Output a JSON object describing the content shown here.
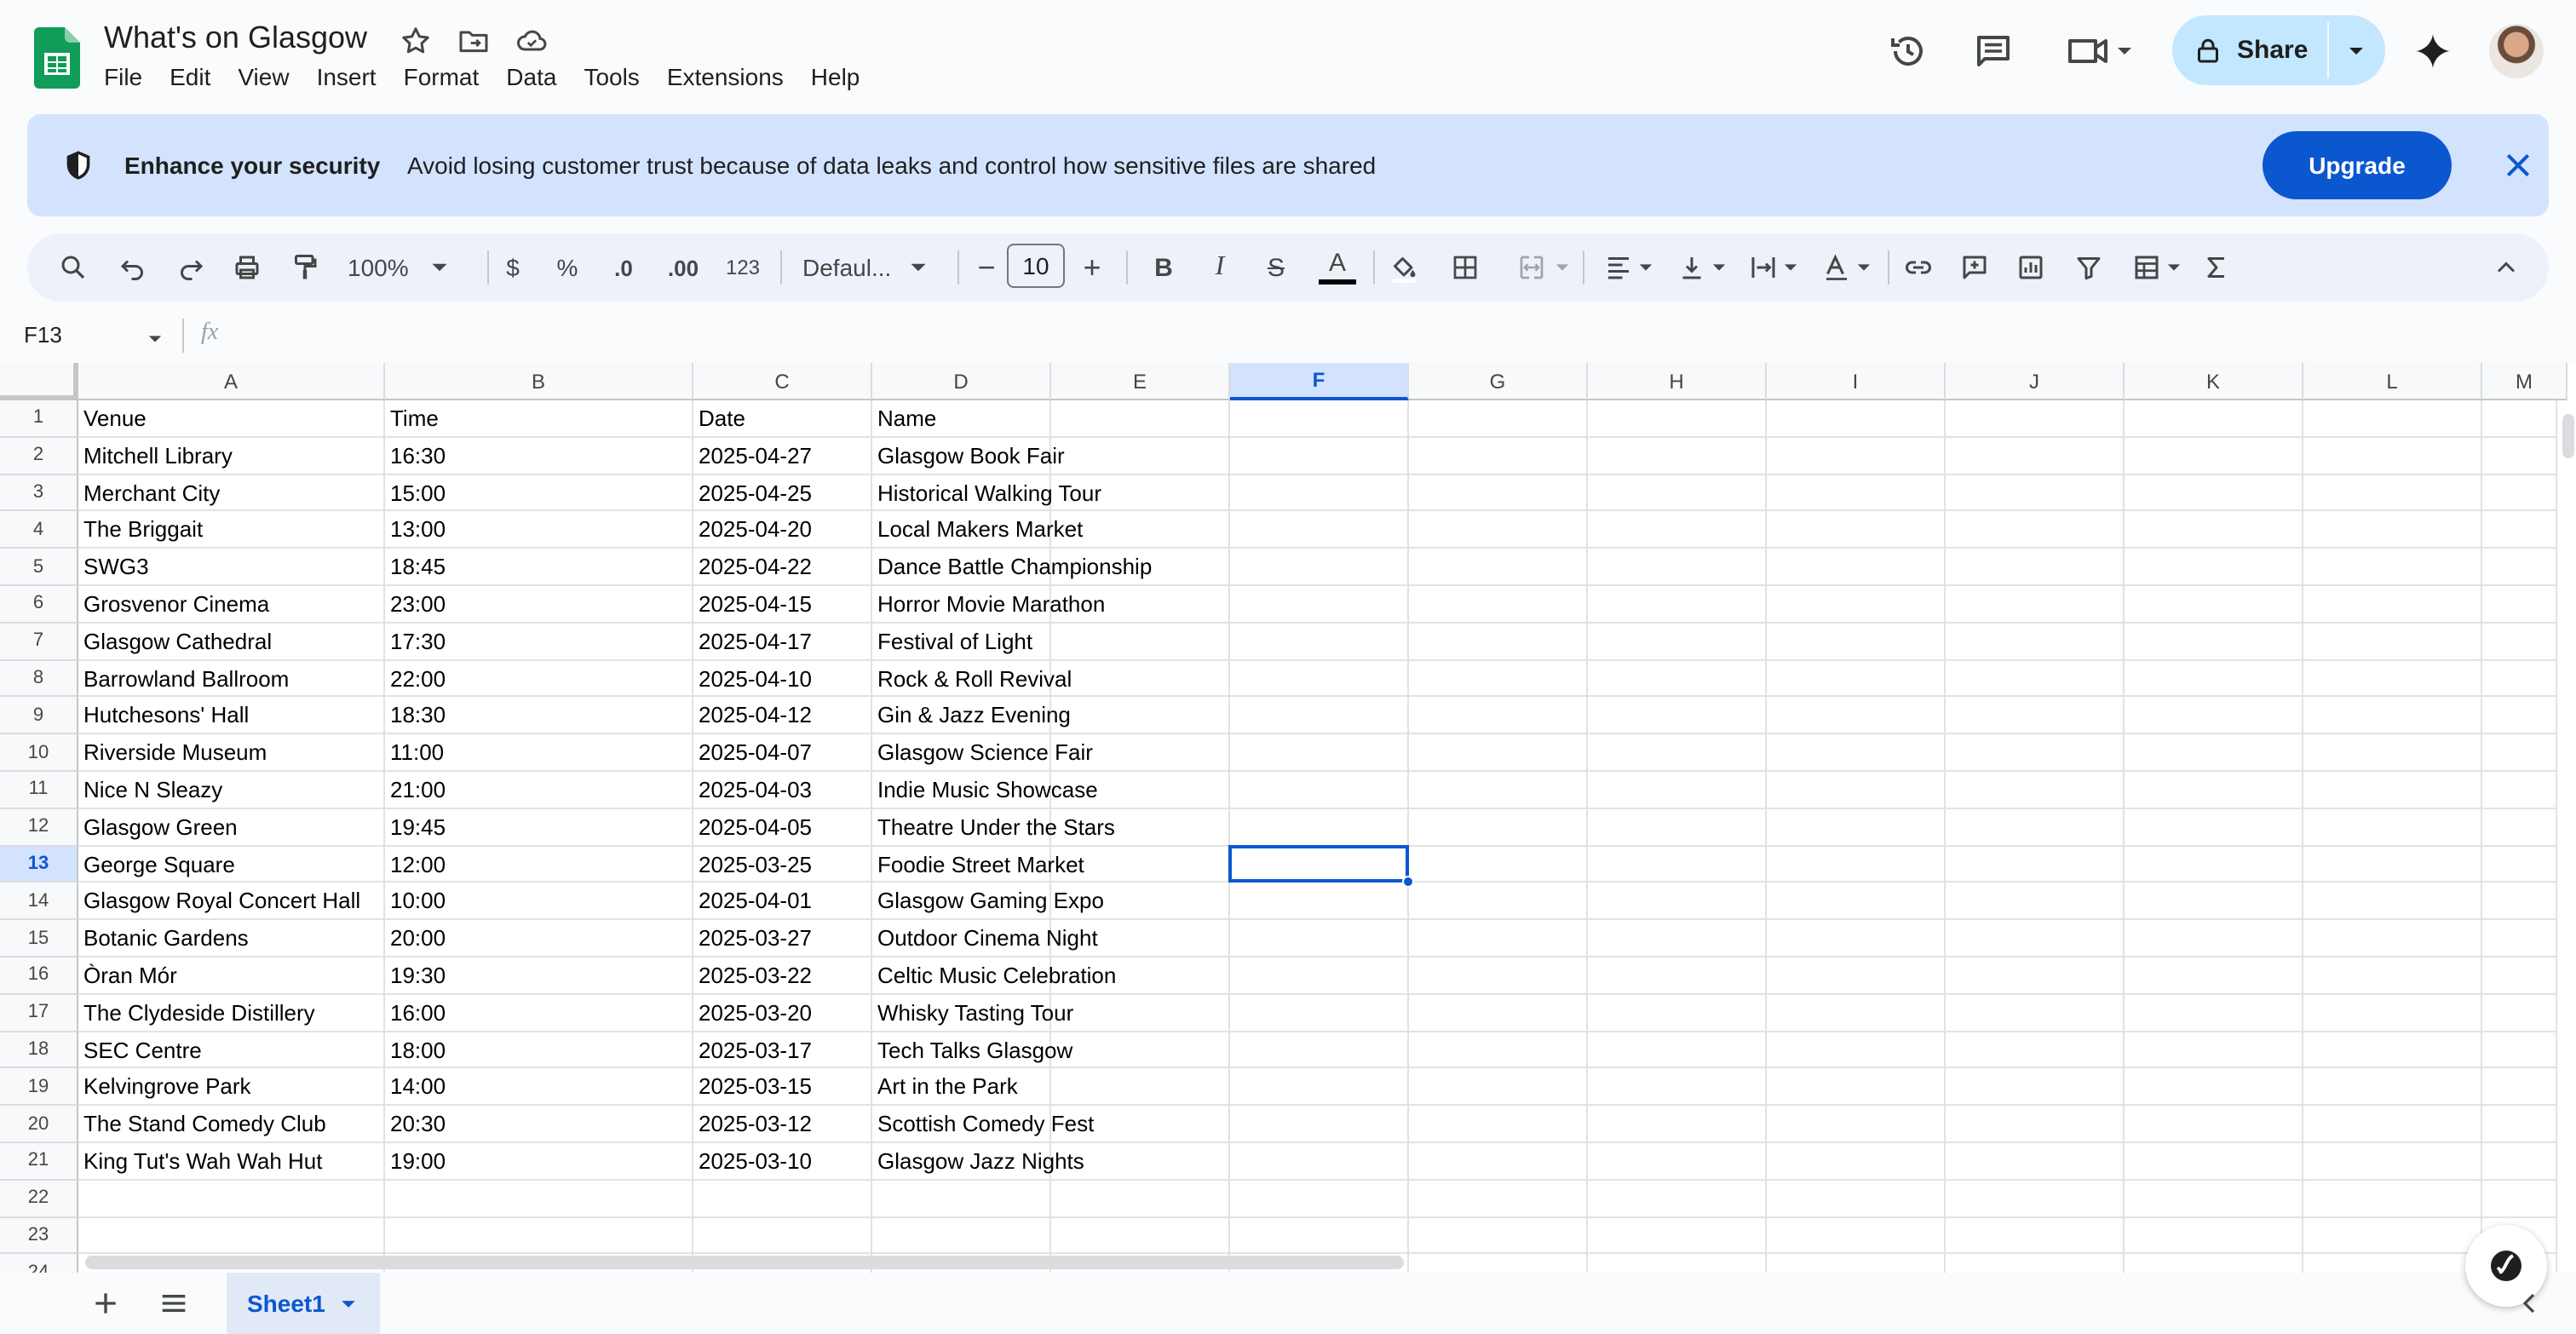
{
  "app": {
    "title": "What's on Glasgow",
    "menu": [
      "File",
      "Edit",
      "View",
      "Insert",
      "Format",
      "Data",
      "Tools",
      "Extensions",
      "Help"
    ],
    "share_label": "Share"
  },
  "banner": {
    "title": "Enhance your security",
    "text": "Avoid losing customer trust because of data leaks and control how sensitive files are shared",
    "upgrade_label": "Upgrade"
  },
  "toolbar": {
    "zoom": "100%",
    "currency": "$",
    "percent": "%",
    "dec_decrease": ".0",
    "dec_increase": ".00",
    "number_format": "123",
    "font": "Defaul...",
    "font_size": "10",
    "minus": "−",
    "plus": "+",
    "bold": "B",
    "italic": "I",
    "strike": "S",
    "text_color": "A"
  },
  "formula_bar": {
    "name_box": "F13",
    "fx": "fx"
  },
  "columns": [
    "A",
    "B",
    "C",
    "D",
    "E",
    "F",
    "G",
    "H",
    "I",
    "J",
    "K",
    "L",
    "M"
  ],
  "selected_column": "F",
  "selected_row": 13,
  "rows": [
    [
      "Venue",
      "Time",
      "Date",
      "Name"
    ],
    [
      "Mitchell Library",
      "16:30",
      "2025-04-27",
      "Glasgow Book Fair"
    ],
    [
      "Merchant City",
      "15:00",
      "2025-04-25",
      "Historical Walking Tour"
    ],
    [
      "The Briggait",
      "13:00",
      "2025-04-20",
      "Local Makers Market"
    ],
    [
      "SWG3",
      "18:45",
      "2025-04-22",
      "Dance Battle Championship"
    ],
    [
      "Grosvenor Cinema",
      "23:00",
      "2025-04-15",
      "Horror Movie Marathon"
    ],
    [
      "Glasgow Cathedral",
      "17:30",
      "2025-04-17",
      "Festival of Light"
    ],
    [
      "Barrowland Ballroom",
      "22:00",
      "2025-04-10",
      "Rock & Roll Revival"
    ],
    [
      "Hutchesons' Hall",
      "18:30",
      "2025-04-12",
      "Gin & Jazz Evening"
    ],
    [
      "Riverside Museum",
      "11:00",
      "2025-04-07",
      "Glasgow Science Fair"
    ],
    [
      "Nice N Sleazy",
      "21:00",
      "2025-04-03",
      "Indie Music Showcase"
    ],
    [
      "Glasgow Green",
      "19:45",
      "2025-04-05",
      "Theatre Under the Stars"
    ],
    [
      "George Square",
      "12:00",
      "2025-03-25",
      "Foodie Street Market"
    ],
    [
      "Glasgow Royal Concert Hall",
      "10:00",
      "2025-04-01",
      "Glasgow Gaming Expo"
    ],
    [
      "Botanic Gardens",
      "20:00",
      "2025-03-27",
      "Outdoor Cinema Night"
    ],
    [
      "Òran Mór",
      "19:30",
      "2025-03-22",
      "Celtic Music Celebration"
    ],
    [
      "The Clydeside Distillery",
      "16:00",
      "2025-03-20",
      "Whisky Tasting Tour"
    ],
    [
      "SEC Centre",
      "18:00",
      "2025-03-17",
      "Tech Talks Glasgow"
    ],
    [
      "Kelvingrove Park",
      "14:00",
      "2025-03-15",
      "Art in the Park"
    ],
    [
      "The Stand Comedy Club",
      "20:30",
      "2025-03-12",
      "Scottish Comedy Fest"
    ],
    [
      "King Tut's Wah Wah Hut",
      "19:00",
      "2025-03-10",
      "Glasgow Jazz Nights"
    ],
    [
      "",
      "",
      "",
      ""
    ],
    [
      "",
      "",
      "",
      ""
    ],
    [
      "",
      "",
      "",
      ""
    ]
  ],
  "sheets": [
    {
      "name": "Sheet1",
      "active": true
    }
  ],
  "colors": {
    "accent": "#0b57d0",
    "share_bg": "#c2e7ff",
    "banner_bg": "#d3e3fd",
    "toolbar_bg": "#edf2fa",
    "sheets_green": "#0f9d58"
  },
  "icons": {
    "logo": "sheets-logo-icon",
    "star": "star-icon",
    "move": "folder-move-icon",
    "cloud": "cloud-status-icon",
    "history": "history-icon",
    "comments": "comment-icon",
    "meet": "video-call-icon",
    "gemini": "gemini-sparkle-icon",
    "lock": "lock-icon",
    "shield": "shield-icon",
    "close": "close-icon"
  }
}
